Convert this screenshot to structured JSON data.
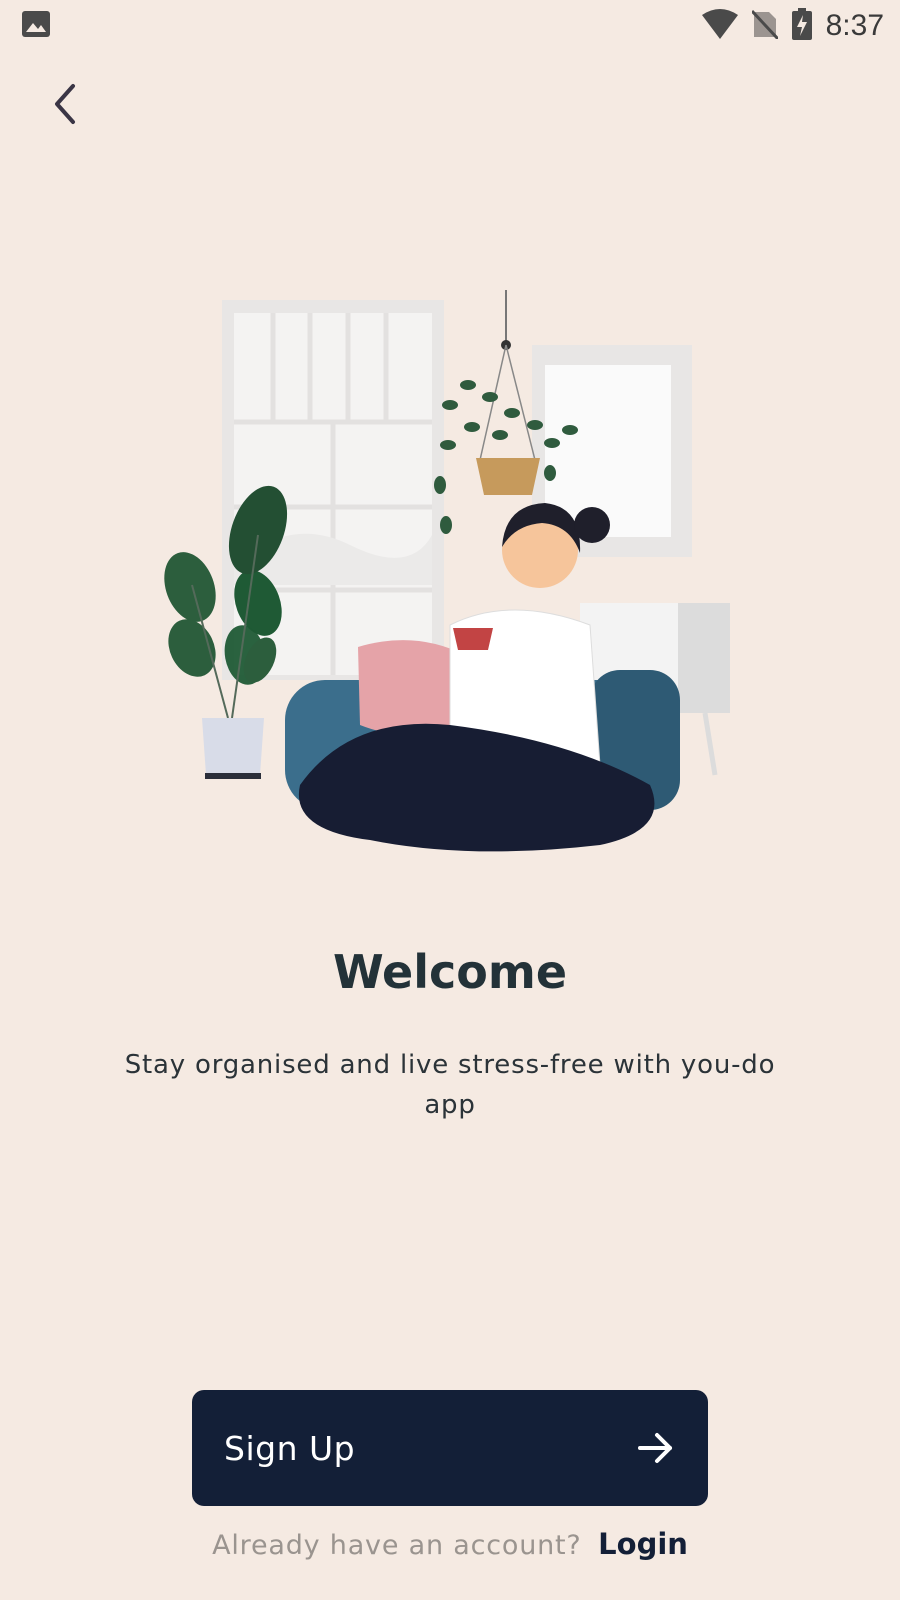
{
  "status_bar": {
    "time": "8:37"
  },
  "header": {
    "back_icon": "chevron-left-icon"
  },
  "welcome": {
    "title": "Welcome",
    "subtitle": "Stay organised and live stress-free with you-do app"
  },
  "actions": {
    "signup_label": "Sign Up",
    "signup_icon": "arrow-right-icon",
    "login_prompt": "Already have an account?",
    "login_label": "Login"
  },
  "colors": {
    "background": "#F5EAE2",
    "primary": "#131F37",
    "title": "#233238",
    "muted": "#9A948F"
  }
}
